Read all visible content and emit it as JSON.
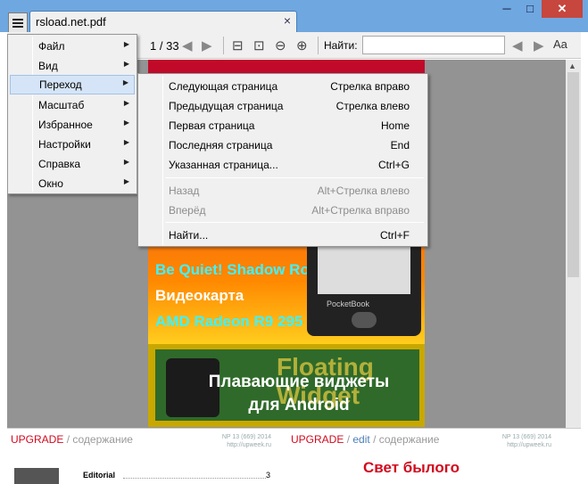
{
  "window": {
    "tab_title": "rsload.net.pdf",
    "tab_close": "×",
    "minimize": "─",
    "maximize": "□",
    "close": "✕"
  },
  "toolbar": {
    "page_current": "1",
    "page_total": "/ 33",
    "find_label": "Найти:",
    "find_value": "",
    "icons": [
      "back-arrow-icon",
      "forward-arrow-icon",
      "fit-page-icon",
      "fit-width-icon",
      "zoom-out-icon",
      "zoom-in-icon",
      "find-prev-icon",
      "find-next-icon",
      "match-case-icon"
    ]
  },
  "main_menu": {
    "items": [
      {
        "label": "Файл",
        "arrow": "▶"
      },
      {
        "label": "Вид",
        "arrow": "▶"
      },
      {
        "label": "Переход",
        "arrow": "▶",
        "active": true
      },
      {
        "label": "Масштаб",
        "arrow": "▶"
      },
      {
        "label": "Избранное",
        "arrow": "▶"
      },
      {
        "label": "Настройки",
        "arrow": "▶"
      },
      {
        "label": "Справка",
        "arrow": "▶"
      },
      {
        "label": "Окно",
        "arrow": "▶"
      }
    ]
  },
  "submenu": {
    "items": [
      {
        "label": "Следующая страница",
        "shortcut": "Стрелка вправо",
        "enabled": true
      },
      {
        "label": "Предыдущая страница",
        "shortcut": "Стрелка влево",
        "enabled": true
      },
      {
        "label": "Первая страница",
        "shortcut": "Home",
        "enabled": true
      },
      {
        "label": "Последняя страница",
        "shortcut": "End",
        "enabled": true
      },
      {
        "label": "Указанная страница...",
        "shortcut": "Ctrl+G",
        "enabled": true
      },
      {
        "label": "Назад",
        "shortcut": "Alt+Стрелка влево",
        "enabled": false
      },
      {
        "label": "Вперёд",
        "shortcut": "Alt+Стрелка вправо",
        "enabled": false
      },
      {
        "label": "Найти...",
        "shortcut": "Ctrl+F",
        "enabled": true
      }
    ]
  },
  "pdf": {
    "line1": "Be Quiet! Shadow Rock 2",
    "line2": "Видеокарта",
    "line3": "AMD Radeon R9 295 X2",
    "device_brand": "PocketBook",
    "banner_bg_text": "Floating Widget",
    "banner_title_1": "Плавающие виджеты",
    "banner_title_2": "для Android"
  },
  "lower": {
    "left": {
      "upgrade": "UPGRADE",
      "slash": "/",
      "section": "содержание",
      "np": "NP 13 (669) 2014",
      "url": "http://upweek.ru",
      "editorial": "Editorial",
      "page": "3"
    },
    "right": {
      "upgrade": "UPGRADE",
      "slash1": "/",
      "edit": "edit",
      "slash2": "/",
      "section": "содержание",
      "np": "NP 13 (669) 2014",
      "url": "http://upweek.ru",
      "headline": "Свет былого"
    }
  },
  "colors": {
    "accent_red": "#d20a1e",
    "title_bar": "#6fa7e0",
    "menu_highlight": "#d5e5f7"
  }
}
